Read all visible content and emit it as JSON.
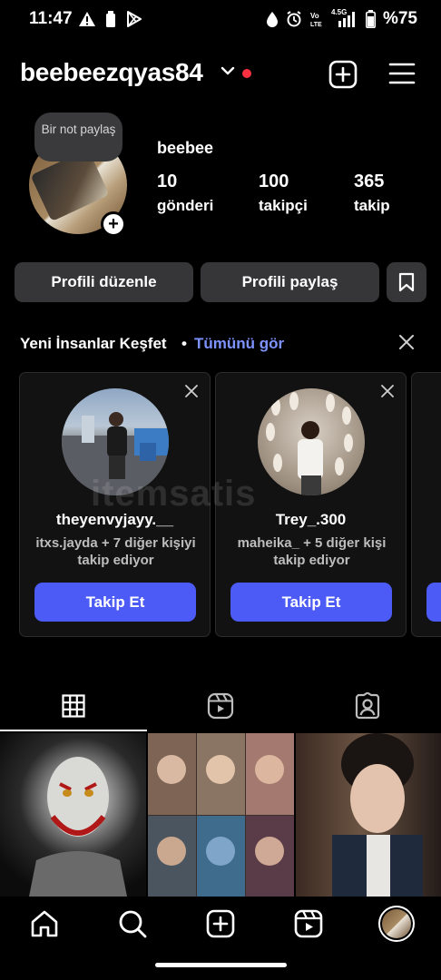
{
  "status_bar": {
    "time": "11:47",
    "battery_text": "%75",
    "network_label": "4.5G"
  },
  "header": {
    "username": "beebeezqyas84"
  },
  "profile": {
    "note_text": "Bir not paylaş",
    "display_name": "beebee",
    "stats": [
      {
        "value": "10",
        "label": "gönderi"
      },
      {
        "value": "100",
        "label": "takipçi"
      },
      {
        "value": "365",
        "label": "takip"
      }
    ]
  },
  "actions": {
    "edit_label": "Profili düzenle",
    "share_label": "Profili paylaş"
  },
  "discover": {
    "title": "Yeni İnsanlar Keşfet",
    "separator": "•",
    "see_all": "Tümünü gör",
    "cards": [
      {
        "username": "theyenvyjayy.__",
        "subtitle": "itxs.jayda + 7 diğer kişiyi takip ediyor",
        "button": "Takip Et"
      },
      {
        "username": "Trey_.300",
        "subtitle": "maheika_ + 5 diğer kişi takip ediyor",
        "button": "Takip Et"
      }
    ]
  },
  "watermark": "itemsatis",
  "colors": {
    "accent": "#4c5bf5",
    "link": "#7d93ff",
    "notification": "#ff3040",
    "button_bg": "#363638"
  }
}
